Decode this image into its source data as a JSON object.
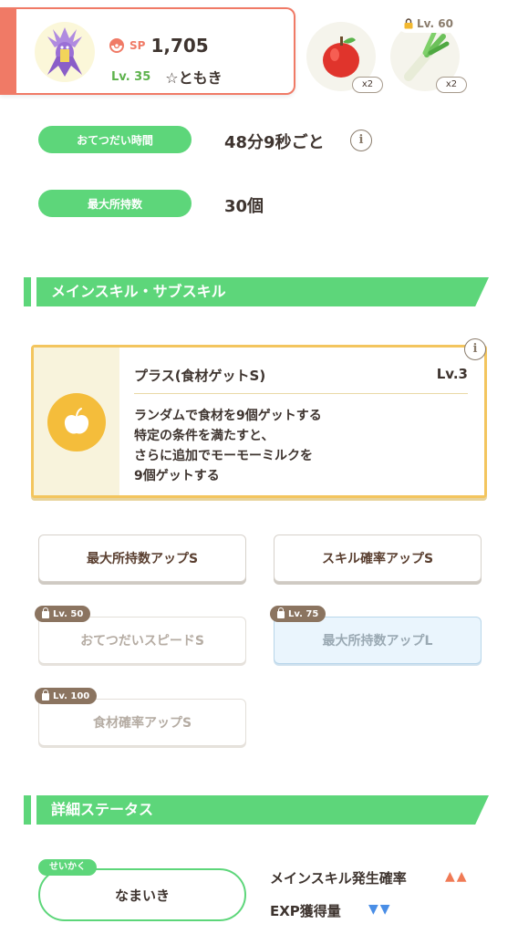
{
  "header": {
    "sp_label": "SP",
    "sp_value": "1,705",
    "level": "Lv. 35",
    "name": "☆ともき",
    "ingredients": [
      {
        "icon": "apple-icon",
        "count": "x2"
      },
      {
        "icon": "leek-icon",
        "count": "x2",
        "lock_level": "Lv. 60"
      }
    ]
  },
  "help_time": {
    "label": "おてつだい時間",
    "value": "48分9秒ごと",
    "info": "i"
  },
  "max_carry": {
    "label": "最大所持数",
    "value": "30個"
  },
  "skills_section": {
    "title": "メインスキル・サブスキル"
  },
  "main_skill": {
    "title": "プラス(食材ゲットS)",
    "level": "Lv.3",
    "info": "i",
    "icon": "apple-icon",
    "description": [
      "ランダムで食材を9個ゲットする",
      "特定の条件を満たすと、",
      "さらに追加でモーモーミルクを",
      "9個ゲットする"
    ]
  },
  "sub_skills": [
    {
      "label": "最大所持数アップS",
      "lock": ""
    },
    {
      "label": "スキル確率アップS",
      "lock": ""
    },
    {
      "label": "おてつだいスピードS",
      "lock": "Lv. 50"
    },
    {
      "label": "最大所持数アップL",
      "lock": "Lv. 75"
    },
    {
      "label": "食材確率アップS",
      "lock": "Lv. 100"
    }
  ],
  "details_section": {
    "title": "詳細ステータス"
  },
  "nature": {
    "tag": "せいかく",
    "value": "なまいき",
    "stats": [
      {
        "label": "メインスキル発生確率",
        "arrows": "▲▲",
        "direction": "up"
      },
      {
        "label": "EXP獲得量",
        "arrows": "▼▼",
        "direction": "down"
      }
    ]
  },
  "colors": {
    "accent_green": "#5dd67a",
    "header_red": "#f07a66",
    "skill_gold": "#f3c55e"
  }
}
